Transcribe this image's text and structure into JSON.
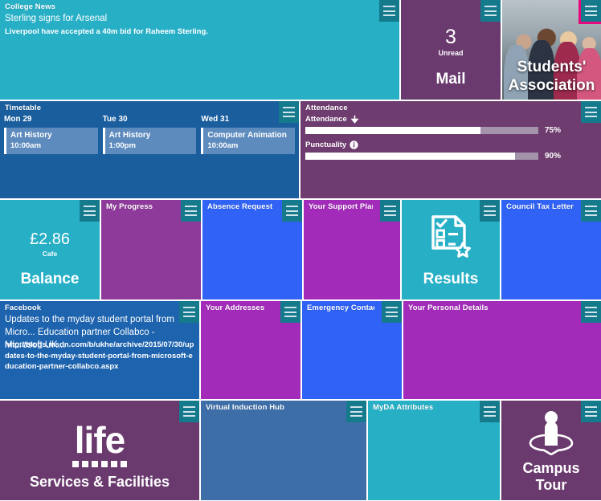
{
  "colors": {
    "cyan": "#27AFC6",
    "teal_dark": "#157A8C",
    "purple_dark": "#6A3A6E",
    "purple_mid": "#6E3C6F",
    "magenta": "#A32BBA",
    "blue_royal": "#2B63D4",
    "blue_bright": "#2F62F5",
    "blue_steel": "#3D6EA8",
    "blue_navy": "#1A5E9E",
    "pink_accent": "#E8087D",
    "white": "#FFFFFF"
  },
  "tiles": {
    "news": {
      "title": "College News",
      "headline": "Sterling signs for Arsenal",
      "body": "Liverpool have accepted a 40m bid for Raheem Sterling."
    },
    "mail": {
      "title": "",
      "count": "3",
      "count_label": "Unread",
      "footer": "Mail"
    },
    "students_association": {
      "title": "",
      "footer_line1": "Students'",
      "footer_line2": "Association",
      "selected": true
    },
    "timetable": {
      "title": "Timetable",
      "days": [
        {
          "day": "Mon 29",
          "event": "Art History",
          "time": "10:00am"
        },
        {
          "day": "Tue 30",
          "event": "Art History",
          "time": "1:00pm"
        },
        {
          "day": "Wed 31",
          "event": "Computer Animation",
          "time": "10:00am"
        }
      ]
    },
    "attendance": {
      "title": "Attendance",
      "rows": [
        {
          "label": "Attendance",
          "icon": "arrow-down-icon",
          "percent": "75%",
          "value": 75
        },
        {
          "label": "Punctuality",
          "icon": "info-icon",
          "percent": "90%",
          "value": 90
        }
      ]
    },
    "balance": {
      "title": "",
      "amount": "£2.86",
      "sub": "Cafe",
      "footer": "Balance"
    },
    "my_progress": {
      "title": "My Progress"
    },
    "absence_request": {
      "title": "Absence Request"
    },
    "your_support_plan": {
      "title": "Your Support Plan"
    },
    "results": {
      "title": "",
      "footer": "Results",
      "icon": "results-document-star-icon"
    },
    "council_tax_letter": {
      "title": "Council Tax Letter"
    },
    "facebook": {
      "title": "Facebook",
      "headline": "Updates to the myday student portal from Micro... Education partner Collabco - Microsoft UK...",
      "url": "http://blogs.msdn.com/b/ukhe/archive/2015/07/30/updates-to-the-myday-student-portal-from-microsoft-education-partner-collabco.aspx"
    },
    "your_addresses": {
      "title": "Your Addresses"
    },
    "emergency_contact": {
      "title": "Emergency Contact"
    },
    "your_personal_details": {
      "title": "Your Personal Details"
    },
    "life_services": {
      "title": "",
      "logo_word": "life",
      "footer": "Services & Facilities"
    },
    "virtual_induction_hub": {
      "title": "Virtual Induction Hub"
    },
    "myda_attributes": {
      "title": "MyDA Attributes"
    },
    "campus_tour": {
      "title": "",
      "footer_line1": "Campus",
      "footer_line2": "Tour",
      "icon": "location-person-icon"
    }
  },
  "menu_button_label": "tile-menu"
}
